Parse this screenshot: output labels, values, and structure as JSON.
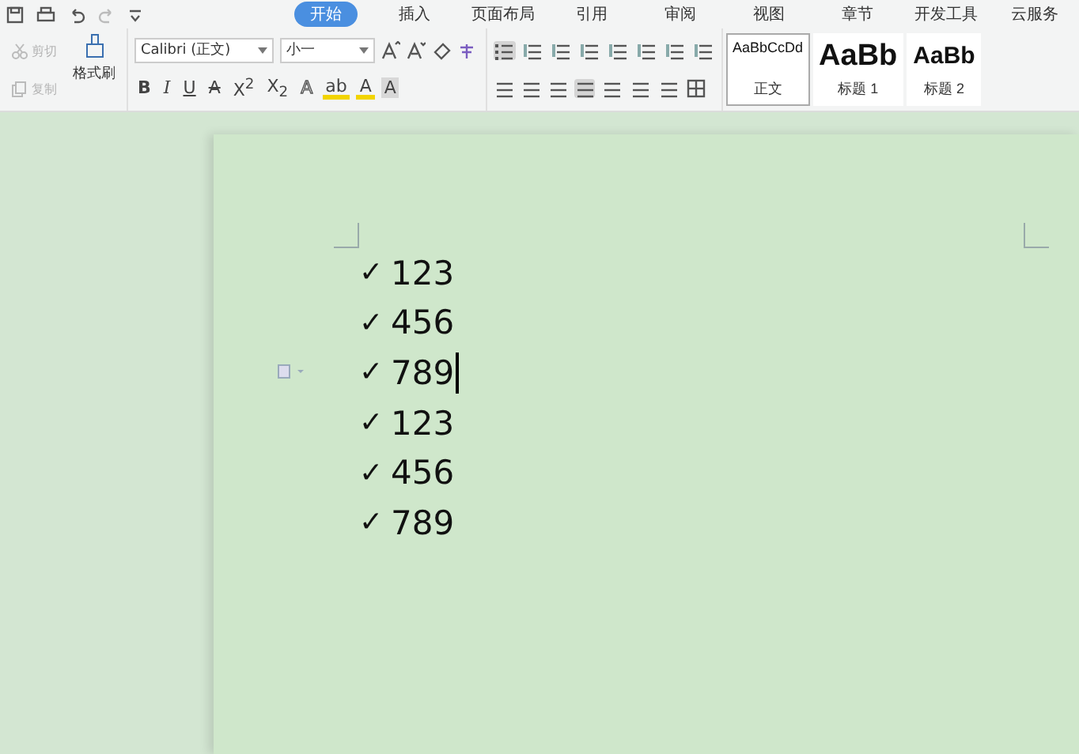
{
  "tabs": [
    {
      "label": "开始",
      "selected": true
    },
    {
      "label": "插入",
      "selected": false
    },
    {
      "label": "页面布局",
      "selected": false
    },
    {
      "label": "引用",
      "selected": false
    },
    {
      "label": "审阅",
      "selected": false
    },
    {
      "label": "视图",
      "selected": false
    },
    {
      "label": "章节",
      "selected": false
    },
    {
      "label": "开发工具",
      "selected": false
    },
    {
      "label": "云服务",
      "selected": false
    }
  ],
  "clipboard": [
    {
      "label": "剪切",
      "kind": "cut",
      "disabled": true
    },
    {
      "label": "复制",
      "kind": "copy",
      "disabled": true
    }
  ],
  "format_painter": {
    "label": "格式刷"
  },
  "font": {
    "name": "Calibri (正文)",
    "size": "小一"
  },
  "font_buttons": [
    {
      "label": "B",
      "kind": "bold"
    },
    {
      "label": "I",
      "kind": "italic"
    },
    {
      "label": "U",
      "kind": "underline"
    },
    {
      "label": "A",
      "kind": "strike"
    },
    {
      "label": "X$^{2}$",
      "kind": "plain"
    },
    {
      "label": "X$_{2}$",
      "kind": "plain"
    },
    {
      "label": "A",
      "kind": "outline"
    },
    {
      "label": "ab",
      "kind": "highlight"
    },
    {
      "label": "A",
      "kind": "color"
    },
    {
      "label": "A",
      "kind": "shade"
    }
  ],
  "styles": [
    {
      "sample": "AaBbCcDd",
      "name": "正文",
      "selected": true
    },
    {
      "sample": "AaBb",
      "name": "标题 1",
      "selected": false
    },
    {
      "sample": "AaBb",
      "name": "标题 2",
      "selected": false
    }
  ],
  "paragraphs": [
    {
      "bullet": "✓",
      "text": "123",
      "cursor": false
    },
    {
      "bullet": "✓",
      "text": "456",
      "cursor": false
    },
    {
      "bullet": "✓",
      "text": "789",
      "cursor": true
    },
    {
      "bullet": "✓",
      "text": "123",
      "cursor": false
    },
    {
      "bullet": "✓",
      "text": "456",
      "cursor": false
    },
    {
      "bullet": "✓",
      "text": "789",
      "cursor": false
    }
  ]
}
